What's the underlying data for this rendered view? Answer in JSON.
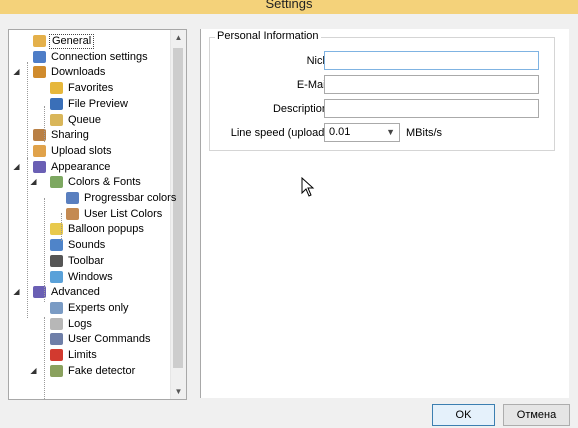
{
  "window": {
    "title": "Settings"
  },
  "tree": {
    "items": [
      {
        "label": "General",
        "icon": "general-icon",
        "color": "#e4b04a",
        "level": 0,
        "toggle": "",
        "selected": true
      },
      {
        "label": "Connection settings",
        "icon": "network-icon",
        "color": "#4e7dc7",
        "level": 0,
        "toggle": ""
      },
      {
        "label": "Downloads",
        "icon": "downloads-icon",
        "color": "#d08b2c",
        "level": 0,
        "toggle": "▲"
      },
      {
        "label": "Favorites",
        "icon": "favorites-icon",
        "color": "#e6b73b",
        "level": 1,
        "toggle": ""
      },
      {
        "label": "File Preview",
        "icon": "preview-icon",
        "color": "#3a6fb8",
        "level": 1,
        "toggle": ""
      },
      {
        "label": "Queue",
        "icon": "queue-icon",
        "color": "#d9b65a",
        "level": 1,
        "toggle": ""
      },
      {
        "label": "Sharing",
        "icon": "sharing-icon",
        "color": "#b98045",
        "level": 0,
        "toggle": ""
      },
      {
        "label": "Upload slots",
        "icon": "upload-icon",
        "color": "#e0a24a",
        "level": 0,
        "toggle": ""
      },
      {
        "label": "Appearance",
        "icon": "appearance-icon",
        "color": "#6a5fb4",
        "level": 0,
        "toggle": "▲"
      },
      {
        "label": "Colors & Fonts",
        "icon": "colors-icon",
        "color": "#7da861",
        "level": 1,
        "toggle": "▲"
      },
      {
        "label": "Progressbar colors",
        "icon": "progressbar-icon",
        "color": "#5a7fbf",
        "level": 2,
        "toggle": ""
      },
      {
        "label": "User List Colors",
        "icon": "user-icon",
        "color": "#c48a52",
        "level": 2,
        "toggle": ""
      },
      {
        "label": "Balloon popups",
        "icon": "balloon-icon",
        "color": "#e8c94c",
        "level": 1,
        "toggle": ""
      },
      {
        "label": "Sounds",
        "icon": "sounds-icon",
        "color": "#4f84c9",
        "level": 1,
        "toggle": ""
      },
      {
        "label": "Toolbar",
        "icon": "toolbar-icon",
        "color": "#555555",
        "level": 1,
        "toggle": ""
      },
      {
        "label": "Windows",
        "icon": "windows-icon",
        "color": "#5aa1d9",
        "level": 1,
        "toggle": ""
      },
      {
        "label": "Advanced",
        "icon": "advanced-icon",
        "color": "#6a5fb4",
        "level": 0,
        "toggle": "▲"
      },
      {
        "label": "Experts only",
        "icon": "experts-icon",
        "color": "#7a9bc4",
        "level": 1,
        "toggle": ""
      },
      {
        "label": "Logs",
        "icon": "logs-icon",
        "color": "#b7b7b7",
        "level": 1,
        "toggle": ""
      },
      {
        "label": "User Commands",
        "icon": "commands-icon",
        "color": "#6f7fa8",
        "level": 1,
        "toggle": ""
      },
      {
        "label": "Limits",
        "icon": "limits-icon",
        "color": "#d23a2f",
        "level": 1,
        "toggle": ""
      },
      {
        "label": "Fake detector",
        "icon": "fake-detector-icon",
        "color": "#8aa15e",
        "level": 1,
        "toggle": "▲"
      }
    ]
  },
  "panel": {
    "group_title": "Personal Information",
    "fields": [
      {
        "label": "Nick",
        "value": "",
        "focused": true
      },
      {
        "label": "E-Mail",
        "value": ""
      },
      {
        "label": "Description",
        "value": ""
      }
    ],
    "line_speed": {
      "label": "Line speed (upload)",
      "value": "0.01",
      "unit": "MBits/s"
    }
  },
  "buttons": {
    "ok": "OK",
    "cancel": "Отмена"
  }
}
